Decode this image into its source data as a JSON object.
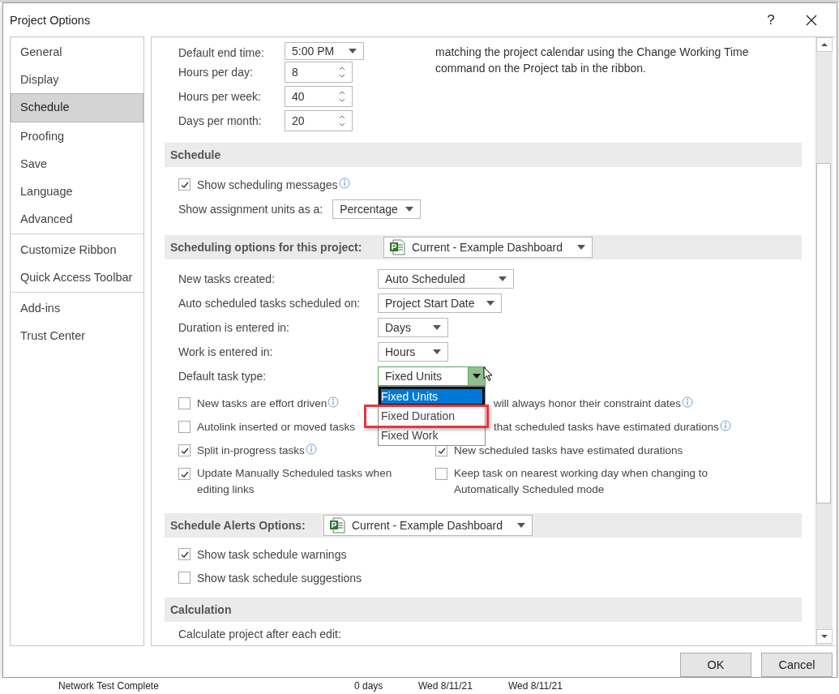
{
  "window": {
    "title": "Project Options",
    "help": "?"
  },
  "sidebar": {
    "groups": [
      [
        {
          "label": "General",
          "selected": false
        },
        {
          "label": "Display",
          "selected": false
        },
        {
          "label": "Schedule",
          "selected": true
        },
        {
          "label": "Proofing",
          "selected": false
        },
        {
          "label": "Save",
          "selected": false
        },
        {
          "label": "Language",
          "selected": false
        },
        {
          "label": "Advanced",
          "selected": false
        }
      ],
      [
        {
          "label": "Customize Ribbon",
          "selected": false
        },
        {
          "label": "Quick Access Toolbar",
          "selected": false
        }
      ],
      [
        {
          "label": "Add-ins",
          "selected": false
        },
        {
          "label": "Trust Center",
          "selected": false
        }
      ]
    ]
  },
  "calendar_fields": [
    {
      "label": "Default end time:",
      "value": "5:00 PM",
      "kind": "dropdown"
    },
    {
      "label": "Hours per day:",
      "value": "8",
      "kind": "spinner"
    },
    {
      "label": "Hours per week:",
      "value": "40",
      "kind": "spinner"
    },
    {
      "label": "Days per month:",
      "value": "20",
      "kind": "spinner"
    }
  ],
  "calendar_note": "matching the project calendar using the Change Working Time command on the Project tab in the ribbon.",
  "schedule": {
    "title": "Schedule",
    "show_messages": {
      "label": "Show scheduling messages",
      "checked": true,
      "info": true
    },
    "assignment_units": {
      "label": "Show assignment units as a:",
      "value": "Percentage"
    }
  },
  "scheduling_options": {
    "title": "Scheduling options for this project:",
    "project": "Current - Example Dashboard",
    "fields": [
      {
        "label": "New tasks created:",
        "value": "Auto Scheduled",
        "open": false
      },
      {
        "label": "Auto scheduled tasks scheduled on:",
        "value": "Project Start Date",
        "open": false
      },
      {
        "label": "Duration is entered in:",
        "value": "Days",
        "open": false
      },
      {
        "label": "Work is entered in:",
        "value": "Hours",
        "open": false
      },
      {
        "label": "Default task type:",
        "value": "Fixed Units",
        "open": true
      }
    ],
    "dropdown_options": [
      {
        "label": "Fixed Units",
        "selected": true,
        "highlighted": false
      },
      {
        "label": "Fixed Duration",
        "selected": false,
        "highlighted": true
      },
      {
        "label": "Fixed Work",
        "selected": false,
        "highlighted": false
      }
    ],
    "checkbox_rows": [
      [
        {
          "kind": "checkbox",
          "label": "New tasks are effort driven",
          "checked": false,
          "info": true
        },
        {
          "kind": "obscured",
          "label": "will always honor their constraint dates",
          "info": true
        }
      ],
      [
        {
          "kind": "checkbox",
          "label": "Autolink inserted or moved tasks",
          "checked": false,
          "info": false
        },
        {
          "kind": "obscured",
          "label": "that scheduled tasks have estimated durations",
          "info": true
        }
      ],
      [
        {
          "kind": "checkbox",
          "label": "Split in-progress tasks",
          "checked": true,
          "info": true
        },
        {
          "kind": "checkbox",
          "label": "New scheduled tasks have estimated durations",
          "checked": true,
          "info": false
        }
      ],
      [
        {
          "kind": "checkbox",
          "label": "Update Manually Scheduled tasks when editing links",
          "checked": true,
          "info": false
        },
        {
          "kind": "checkbox",
          "label": "Keep task on nearest working day when changing to Automatically Scheduled mode",
          "checked": false,
          "info": false
        }
      ]
    ]
  },
  "alerts": {
    "title": "Schedule Alerts Options:",
    "project": "Current - Example Dashboard",
    "checkboxes": [
      {
        "label": "Show task schedule warnings",
        "checked": true
      },
      {
        "label": "Show task schedule suggestions",
        "checked": false
      }
    ]
  },
  "calculation": {
    "title": "Calculation",
    "label": "Calculate project after each edit:"
  },
  "buttons": [
    "OK",
    "Cancel"
  ],
  "background_row": [
    "Network Test Complete",
    "0 days",
    "Wed 8/11/21",
    "Wed 8/11/21"
  ]
}
